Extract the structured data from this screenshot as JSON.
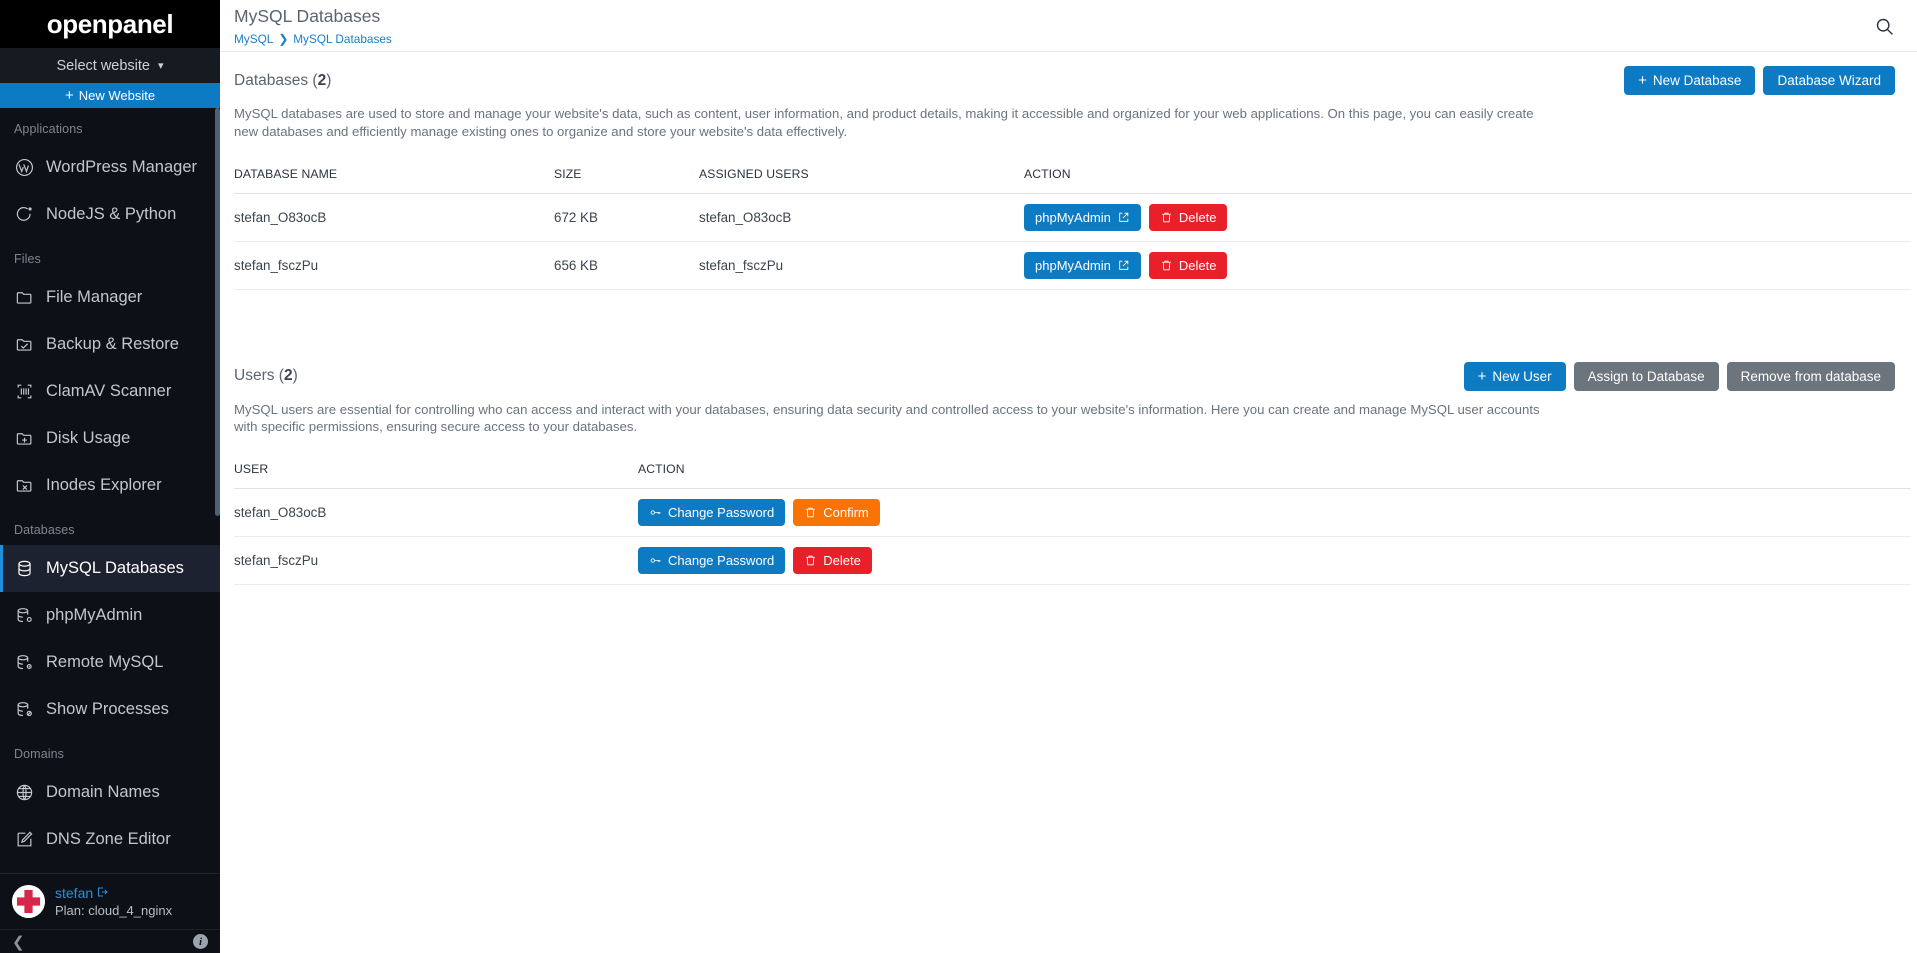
{
  "sidebar": {
    "brand": "openpanel",
    "site_select": "Select website",
    "new_website": "New Website",
    "sections": [
      {
        "label": "Applications",
        "items": [
          {
            "label": "WordPress Manager",
            "icon": "wordpress-icon",
            "active": false
          },
          {
            "label": "NodeJS & Python",
            "icon": "nodejs-icon",
            "active": false
          }
        ]
      },
      {
        "label": "Files",
        "items": [
          {
            "label": "File Manager",
            "icon": "folder-icon",
            "active": false
          },
          {
            "label": "Backup & Restore",
            "icon": "folder-check-icon",
            "active": false
          },
          {
            "label": "ClamAV Scanner",
            "icon": "scan-icon",
            "active": false
          },
          {
            "label": "Disk Usage",
            "icon": "folder-plus-icon",
            "active": false
          },
          {
            "label": "Inodes Explorer",
            "icon": "folder-x-icon",
            "active": false
          }
        ]
      },
      {
        "label": "Databases",
        "items": [
          {
            "label": "MySQL Databases",
            "icon": "database-icon",
            "active": true
          },
          {
            "label": "phpMyAdmin",
            "icon": "database-gear-icon",
            "active": false
          },
          {
            "label": "Remote MySQL",
            "icon": "database-info-icon",
            "active": false
          },
          {
            "label": "Show Processes",
            "icon": "database-ban-icon",
            "active": false
          }
        ]
      },
      {
        "label": "Domains",
        "items": [
          {
            "label": "Domain Names",
            "icon": "globe-icon",
            "active": false
          },
          {
            "label": "DNS Zone Editor",
            "icon": "edit-square-icon",
            "active": false
          }
        ]
      }
    ],
    "user": {
      "name": "stefan",
      "plan": "Plan: cloud_4_nginx",
      "avatar_icon": "red-cross-avatar-icon",
      "logout_icon": "logout-icon"
    },
    "footer": {
      "collapse_icon": "chevron-left-icon",
      "info_icon": "info-icon",
      "info_label": "i"
    }
  },
  "topbar": {
    "title": "MySQL Databases",
    "breadcrumb": [
      "MySQL",
      "MySQL Databases"
    ],
    "breadcrumb_separator": "❯",
    "search_icon": "search-icon"
  },
  "databases_section": {
    "title_text": "Databases (",
    "count": "2",
    "title_suffix": ")",
    "buttons": {
      "new_database": "New Database",
      "new_database_plus": "+",
      "database_wizard": "Database Wizard"
    },
    "description": "MySQL databases are used to store and manage your website's data, such as content, user information, and product details, making it accessible and organized for your web applications. On this page, you can easily create new databases and efficiently manage existing ones to organize and store your website's data effectively.",
    "columns": [
      "DATABASE NAME",
      "SIZE",
      "ASSIGNED USERS",
      "ACTION"
    ],
    "rows": [
      {
        "name": "stefan_O83ocB",
        "size": "672 KB",
        "assigned_users": "stefan_O83ocB",
        "action_primary": "phpMyAdmin",
        "action_danger": "Delete"
      },
      {
        "name": "stefan_fsczPu",
        "size": "656 KB",
        "assigned_users": "stefan_fsczPu",
        "action_primary": "phpMyAdmin",
        "action_danger": "Delete"
      }
    ]
  },
  "users_section": {
    "title_text": "Users (",
    "count": "2",
    "title_suffix": ")",
    "buttons": {
      "new_user": "New  User",
      "new_user_plus": "+",
      "assign_to_database": "Assign  to Database",
      "remove_from_database": "Remove  from database"
    },
    "description": "MySQL users are essential for controlling who can access and interact with your databases, ensuring data security and controlled access to your website's information. Here you can create and manage MySQL user accounts with specific permissions, ensuring secure access to your databases.",
    "columns": [
      "USER",
      "ACTION"
    ],
    "rows": [
      {
        "user": "stefan_O83ocB",
        "action_primary": "Change Password",
        "action_secondary": "Confirm",
        "action_secondary_style": "orange"
      },
      {
        "user": "stefan_fsczPu",
        "action_primary": "Change Password",
        "action_secondary": "Delete",
        "action_secondary_style": "red"
      }
    ]
  },
  "colors": {
    "brand_black": "#000000",
    "sidebar_bg": "#0d1117",
    "accent_blue": "#0d7ac4",
    "active_accent": "#1f8fe0",
    "danger_red": "#e8202a",
    "warning_orange": "#f97306",
    "neutral_gray": "#6c757d",
    "link_blue": "#1b7fc4"
  }
}
